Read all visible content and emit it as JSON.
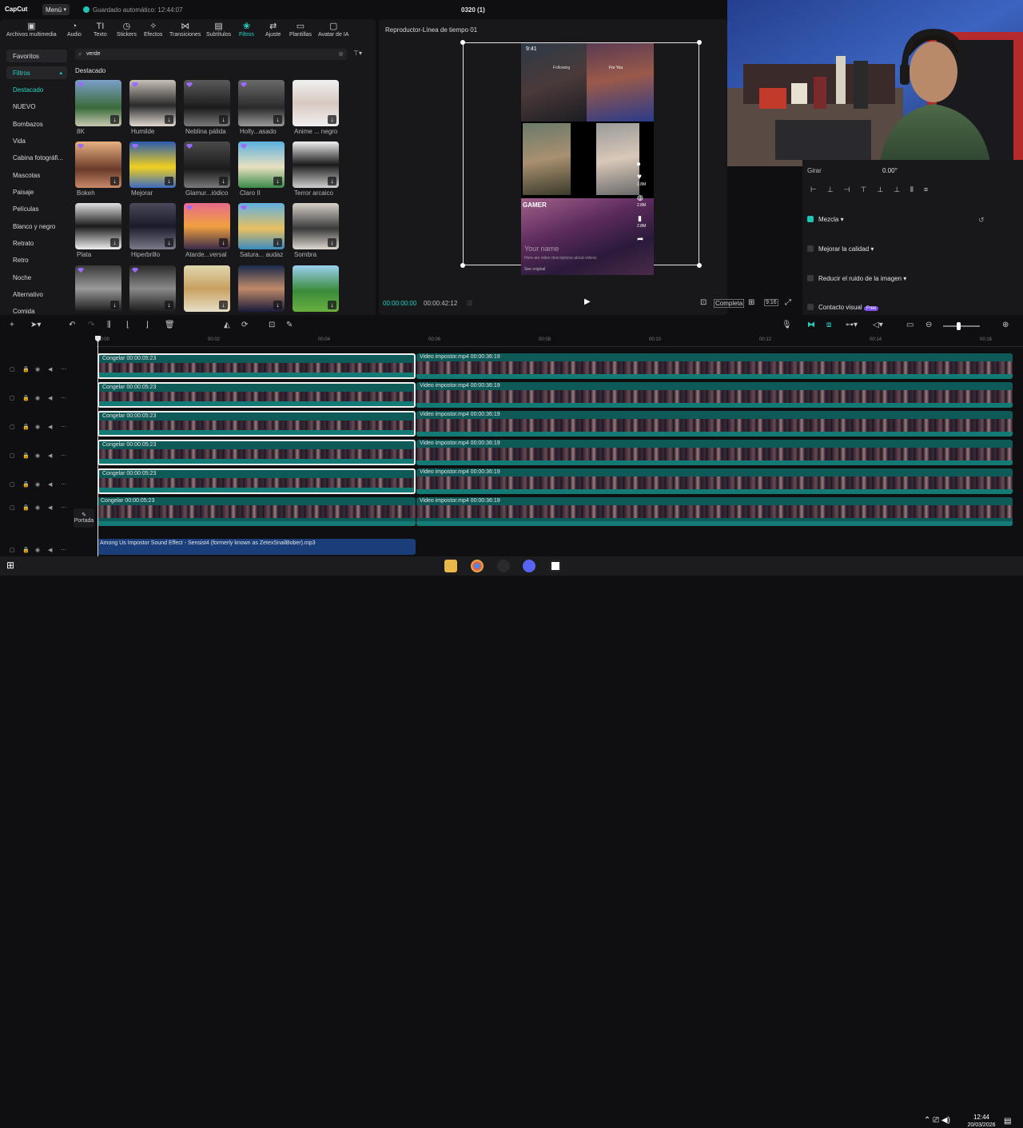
{
  "app": {
    "logo": "CapCut",
    "menu_label": "Menú",
    "autosave": "Guardado automático: 12:44:07",
    "project_title": "0320 (1)"
  },
  "toolbar": [
    {
      "label": "Archivos multimedia",
      "icon": "media-icon"
    },
    {
      "label": "Audio",
      "icon": "audio-icon"
    },
    {
      "label": "Texto",
      "icon": "text-icon"
    },
    {
      "label": "Stickers",
      "icon": "sticker-icon"
    },
    {
      "label": "Efectos",
      "icon": "effects-icon"
    },
    {
      "label": "Transiciones",
      "icon": "transition-icon"
    },
    {
      "label": "Subtítulos",
      "icon": "subtitle-icon"
    },
    {
      "label": "Filtros",
      "icon": "filter-icon"
    },
    {
      "label": "Ajuste",
      "icon": "adjust-icon"
    },
    {
      "label": "Plantillas",
      "icon": "template-icon"
    },
    {
      "label": "Avatar de IA",
      "icon": "avatar-icon"
    }
  ],
  "categories": {
    "favorites": "Favoritos",
    "filters": "Filtros",
    "items": [
      "Destacado",
      "NUEVO",
      "Bombazos",
      "Vida",
      "Cabina fotográfi...",
      "Mascotas",
      "Paisaje",
      "Películas",
      "Blanco y negro",
      "Retrato",
      "Retro",
      "Noche",
      "Alternativo",
      "Comida"
    ]
  },
  "search": {
    "value": "verde"
  },
  "section_title": "Destacado",
  "filters": [
    {
      "name": "8K"
    },
    {
      "name": "Humilde"
    },
    {
      "name": "Neblina pálida"
    },
    {
      "name": "Holly...asado"
    },
    {
      "name": "Anime ... negro"
    },
    {
      "name": "Bokeh"
    },
    {
      "name": "Mejorar"
    },
    {
      "name": "Glamur...iódico"
    },
    {
      "name": "Claro II"
    },
    {
      "name": "Terror arcaico"
    },
    {
      "name": "Plata"
    },
    {
      "name": "Hiperbrillo"
    },
    {
      "name": "Atarde...versal"
    },
    {
      "name": "Satura... audaz"
    },
    {
      "name": "Sombra"
    },
    {
      "name": ""
    },
    {
      "name": ""
    },
    {
      "name": ""
    },
    {
      "name": ""
    },
    {
      "name": ""
    }
  ],
  "player": {
    "title": "Reproductor-Línea de tiempo 01",
    "current_time": "00:00:00:00",
    "total_time": "00:00:42:12",
    "full_label": "Completa",
    "ratio_label": "9:16",
    "overlay": {
      "clock": "9:41",
      "following": "Following",
      "for_you": "For You",
      "likes_1": "2.8M",
      "likes_2": "2.8M",
      "likes_3": "2.8M",
      "gamer": "GAMER",
      "your_name": "Your name",
      "desc": "Here are video descriptions about videos",
      "see_original": "See original"
    }
  },
  "props": {
    "rotate_label": "Girar",
    "rotate_value": "0.00°",
    "blend": "Mezcla",
    "quality": "Mejorar la calidad",
    "noise": "Reducir el ruido de la imagen",
    "contact": "Contacto visual",
    "free_badge": "Free"
  },
  "timeline": {
    "ruler": [
      "00:00",
      "00:02",
      "00:04",
      "00:06",
      "00:08",
      "00:10",
      "00:12",
      "00:14",
      "00:16"
    ],
    "tracks": [
      {
        "freeze": "Congelar  00:00:05:23",
        "video": "Video impostor.mp4  00:00:36:19"
      },
      {
        "freeze": "Congelar  00:00:05:23",
        "video": "Video impostor.mp4  00:00:36:19"
      },
      {
        "freeze": "Congelar  00:00:05:23",
        "video": "Video impostor.mp4  00:00:36:19"
      },
      {
        "freeze": "Congelar  00:00:05:23",
        "video": "Video impostor.mp4  00:00:36:19"
      },
      {
        "freeze": "Congelar  00:00:05:23",
        "video": "Video impostor.mp4  00:00:36:19"
      },
      {
        "freeze": "Congelar  00:00:05:23",
        "video": "Video impostor.mp4  00:00:36:19"
      }
    ],
    "cover_label": "Portada",
    "audio_clip": "Among Us Impostor Sound Effect - Sensist4 (formerly known as ZetexSnailBober).mp3"
  },
  "taskbar": {
    "time": "12:44",
    "date": "20/03/2026"
  },
  "colors": {
    "accent": "#22d3c5",
    "clip": "#0e5a58",
    "audio": "#1a3e7a"
  }
}
